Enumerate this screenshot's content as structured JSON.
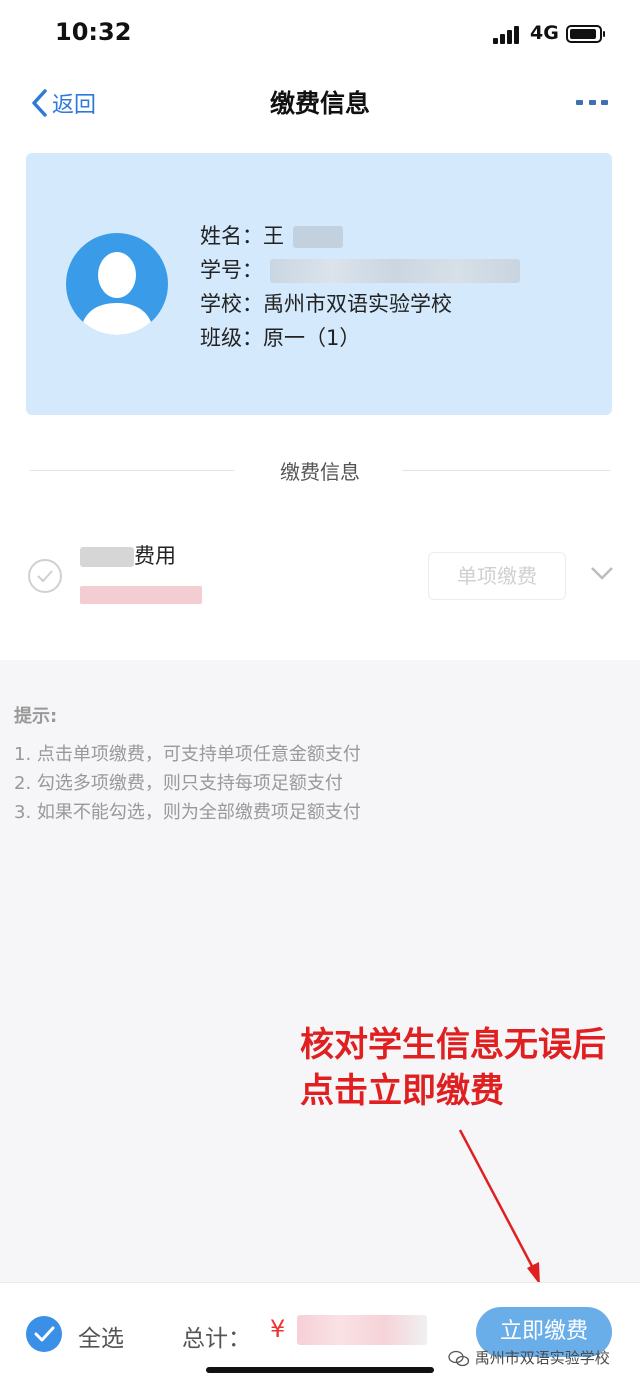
{
  "status_bar": {
    "time": "10:32",
    "network": "4G"
  },
  "nav": {
    "back_label": "返回",
    "title": "缴费信息"
  },
  "student": {
    "name_label": "姓名：",
    "name_value": "王",
    "id_label": "学号：",
    "school_label": "学校：",
    "school_value": "禹州市双语实验学校",
    "class_label": "班级：",
    "class_value": "原一（1）"
  },
  "section": {
    "title": "缴费信息"
  },
  "fee_item": {
    "name": "费用",
    "single_pay_label": "单项缴费"
  },
  "tips": {
    "title": "提示:",
    "items": [
      "1. 点击单项缴费，可支持单项任意金额支付",
      "2. 勾选多项缴费，则只支持每项足额支付",
      "3. 如果不能勾选，则为全部缴费项足额支付"
    ]
  },
  "annotation": {
    "line1": "核对学生信息无误后",
    "line2": "点击立即缴费"
  },
  "bottom_bar": {
    "select_all_label": "全选",
    "total_label": "总计：",
    "currency": "¥",
    "pay_label": "立即缴费"
  },
  "watermark": {
    "text": "禹州市双语实验学校"
  },
  "colors": {
    "accent": "#3a8fe6",
    "card_bg": "#d4e9fb",
    "annotation": "#e02020",
    "pay_button": "#6aaee9"
  }
}
